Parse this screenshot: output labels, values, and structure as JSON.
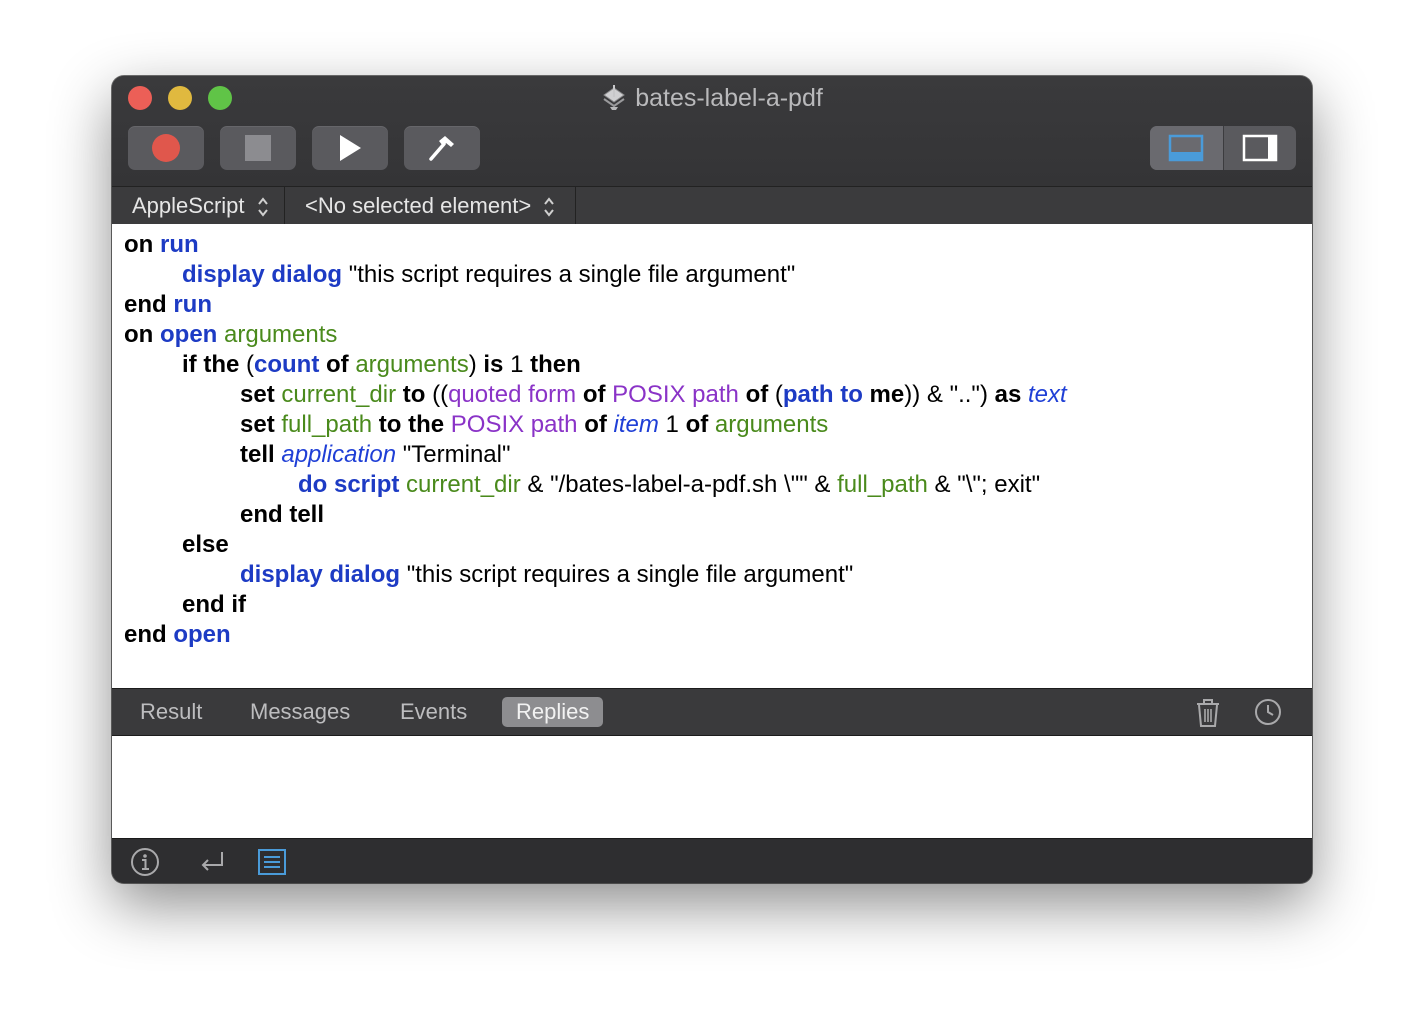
{
  "window": {
    "title": "bates-label-a-pdf",
    "app_icon": "script-editor-icon"
  },
  "toolbar": {
    "buttons": [
      {
        "name": "record",
        "icon": "record-icon"
      },
      {
        "name": "stop",
        "icon": "stop-icon"
      },
      {
        "name": "run",
        "icon": "play-icon"
      },
      {
        "name": "compile",
        "icon": "hammer-icon"
      }
    ],
    "view_toggle": {
      "selected": "bottom-panel",
      "options": [
        "bottom-panel-icon",
        "side-panel-icon"
      ]
    },
    "accent_color": "#4a9bd9"
  },
  "navigator": {
    "language": "AppleScript",
    "element": "<No selected element>"
  },
  "editor": {
    "colors": {
      "language_keyword": "#000000",
      "application_keyword": "#1d3bc4",
      "variable": "#4a8a1c",
      "property": "#8a33c7",
      "class": "#1f3fd6",
      "text": "#000000"
    },
    "lines": [
      {
        "t": "on run"
      },
      {
        "t": "display dialog \"this script requires a single file argument\""
      },
      {
        "t": "end run"
      },
      {
        "t": "on open arguments"
      },
      {
        "t": "if the (count of arguments) is 1 then"
      },
      {
        "t": "set current_dir to ((quoted form of POSIX path of (path to me)) & \"..\") as text"
      },
      {
        "t": "set full_path to the POSIX path of item 1 of arguments"
      },
      {
        "t": "tell application \"Terminal\""
      },
      {
        "t": "do script current_dir & \"/bates-label-a-pdf.sh \\\"\" & full_path & \"\\\"; exit\""
      },
      {
        "t": "end tell"
      },
      {
        "t": "else"
      },
      {
        "t": "display dialog \"this script requires a single file argument\""
      },
      {
        "t": "end if"
      },
      {
        "t": "end open"
      }
    ]
  },
  "log": {
    "tabs": [
      "Result",
      "Messages",
      "Events",
      "Replies"
    ],
    "selected_tab": "Replies",
    "actions": [
      "trash-icon",
      "clock-icon"
    ]
  },
  "bottom_bar": {
    "buttons": [
      "info-icon",
      "return-icon",
      "list-icon"
    ],
    "selected": "list-icon"
  }
}
